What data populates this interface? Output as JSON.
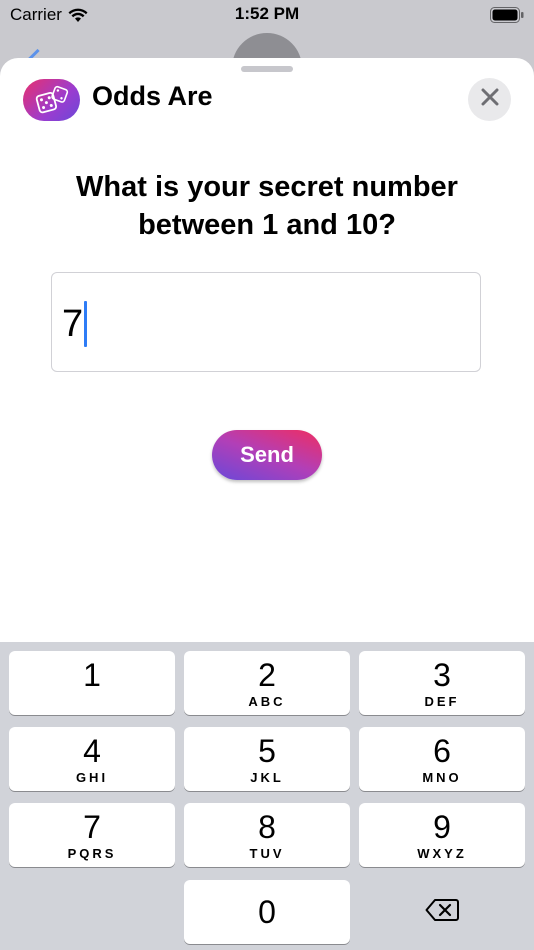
{
  "status_bar": {
    "carrier": "Carrier",
    "time": "1:52 PM"
  },
  "sheet": {
    "app_name": "Odds Are",
    "app_icon": "dice-icon",
    "close_icon": "close-icon",
    "question": "What is your secret number between 1 and 10?",
    "input_value": "7",
    "send_label": "Send"
  },
  "keyboard": {
    "keys": [
      {
        "num": "1",
        "letters": ""
      },
      {
        "num": "2",
        "letters": "ABC"
      },
      {
        "num": "3",
        "letters": "DEF"
      },
      {
        "num": "4",
        "letters": "GHI"
      },
      {
        "num": "5",
        "letters": "JKL"
      },
      {
        "num": "6",
        "letters": "MNO"
      },
      {
        "num": "7",
        "letters": "PQRS"
      },
      {
        "num": "8",
        "letters": "TUV"
      },
      {
        "num": "9",
        "letters": "WXYZ"
      },
      {
        "num": "0",
        "letters": ""
      }
    ],
    "delete_icon": "backspace-icon"
  },
  "colors": {
    "accent_gradient_start": "#6a48d8",
    "accent_gradient_end": "#ef2d62",
    "cursor": "#2e7cf6",
    "keyboard_bg": "#d1d3d9"
  }
}
